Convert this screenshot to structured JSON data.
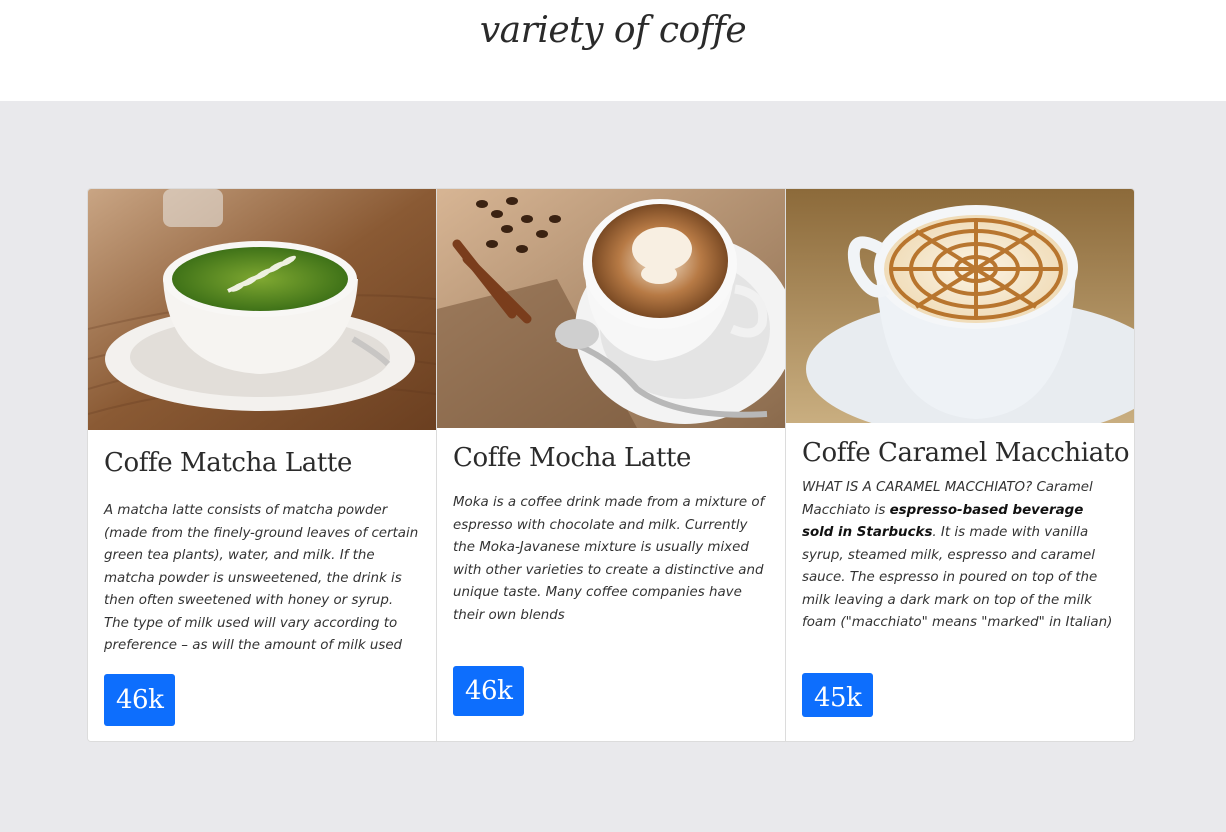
{
  "page": {
    "title": "variety of coffe"
  },
  "cards": [
    {
      "title": "Coffe Matcha Latte",
      "text": "A matcha latte consists of matcha powder (made from the finely-ground leaves of certain green tea plants), water, and milk. If the matcha powder is unsweetened, the drink is then often sweetened with honey or syrup. The type of milk used will vary according to preference – as will the amount of milk used",
      "views": "46k"
    },
    {
      "title": "Coffe Mocha Latte",
      "text": "Moka is a coffee drink made from a mixture of espresso with chocolate and milk. Currently the Moka-Javanese mixture is usually mixed with other varieties to create a distinctive and unique taste. Many coffee companies have their own blends",
      "views": "46k"
    },
    {
      "title": "Coffe Caramel Macchiato",
      "text_before": "WHAT IS A CARAMEL MACCHIATO? Caramel Macchiato is ",
      "text_bold": "espresso-based beverage sold in Starbucks",
      "text_after": ". It is made with vanilla syrup, steamed milk, espresso and caramel sauce. The espresso in poured on top of the milk leaving a dark mark on top of the milk foam (\"macchiato\" means \"marked\" in Italian)",
      "views": "45k"
    }
  ],
  "colors": {
    "background": "#e9e9ec",
    "header": "#ffffff",
    "button": "#0d6efd",
    "text": "#333333"
  },
  "images": [
    "matcha-latte-photo",
    "mocha-latte-photo",
    "caramel-macchiato-photo"
  ]
}
